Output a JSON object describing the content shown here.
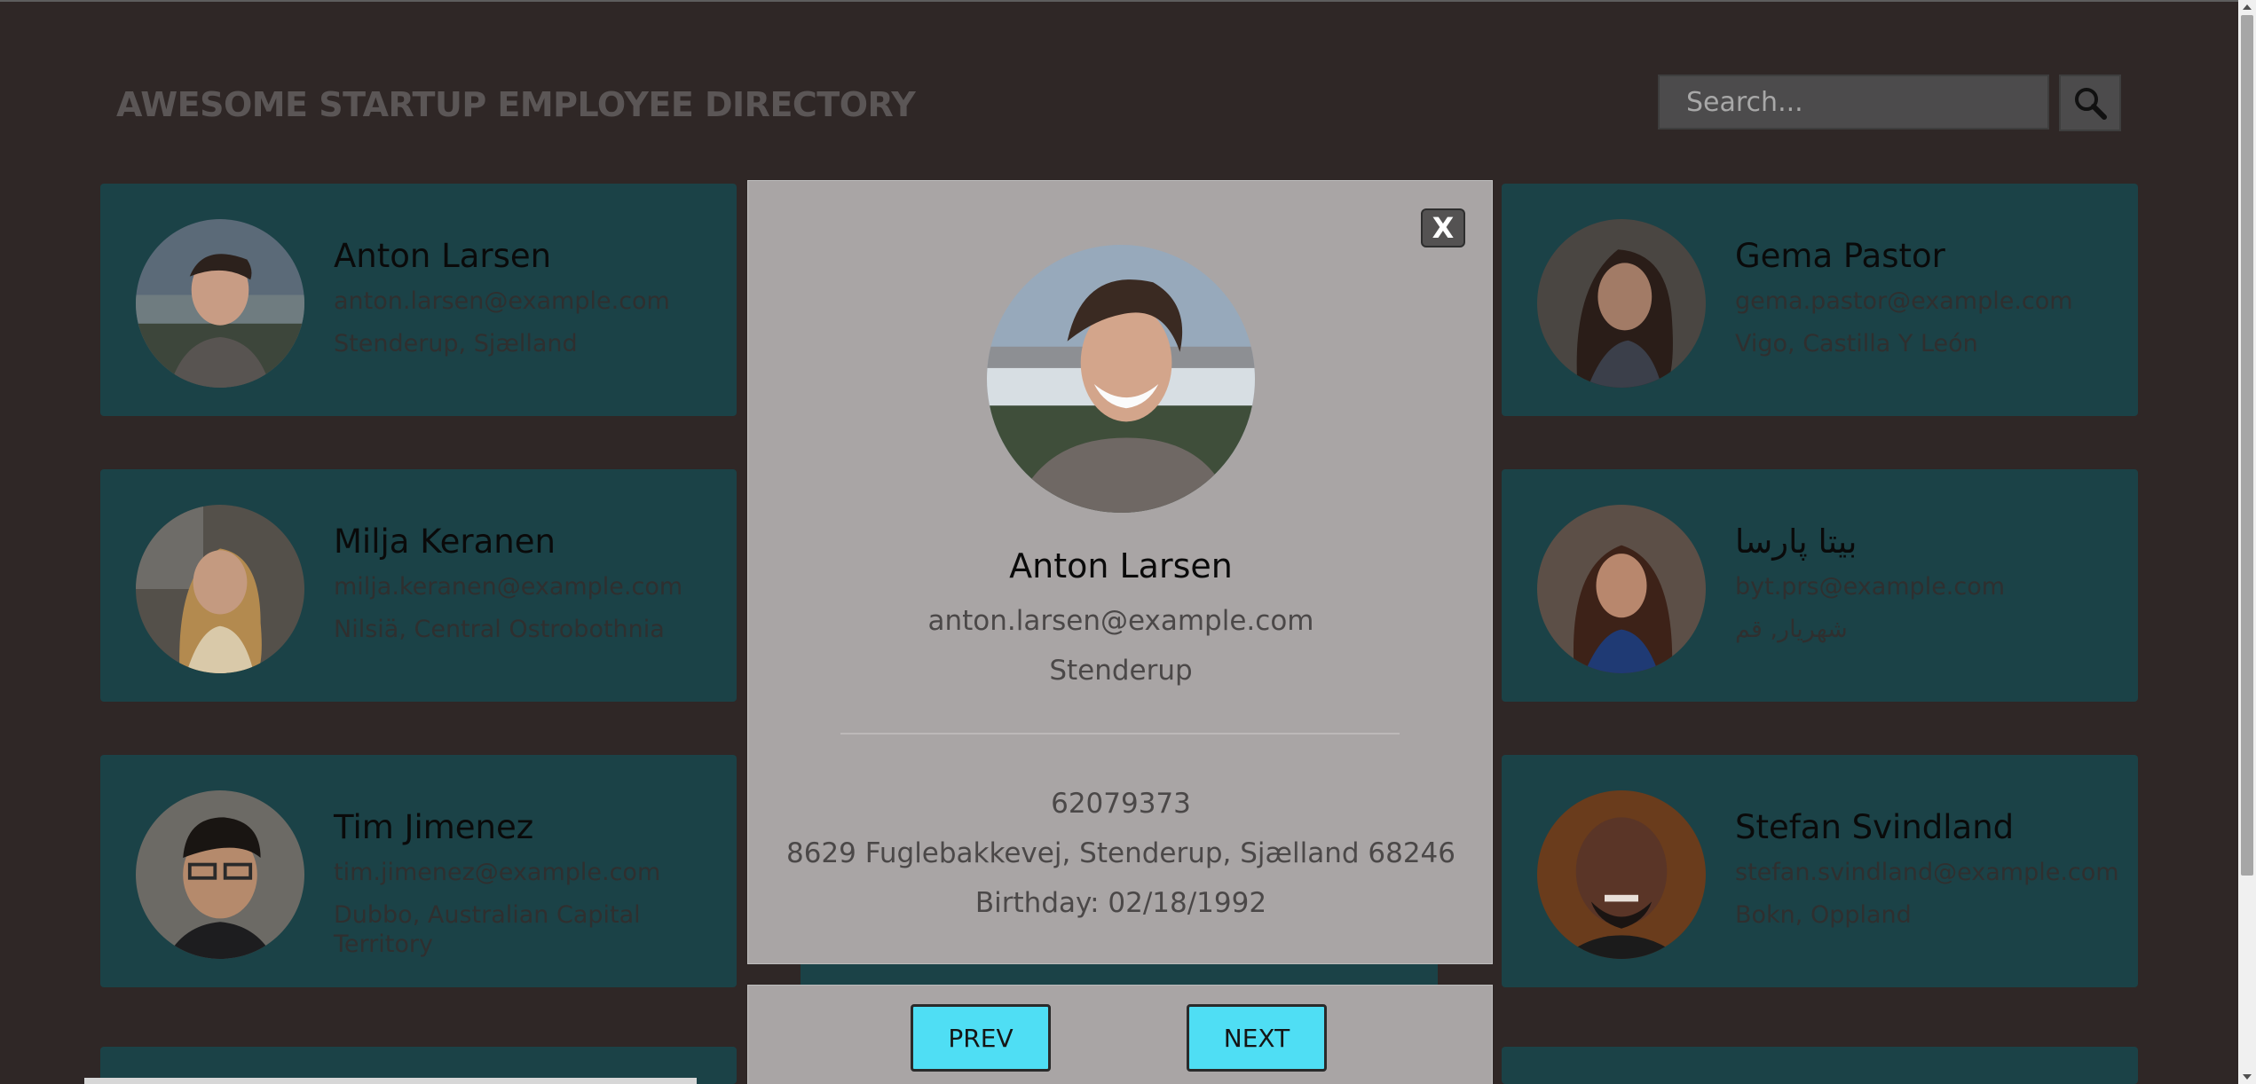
{
  "header": {
    "title": "AWESOME STARTUP EMPLOYEE DIRECTORY",
    "search_placeholder": "Search..."
  },
  "employees": [
    {
      "name": "Anton Larsen",
      "email": "anton.larsen@example.com",
      "location": "Stenderup, Sjælland",
      "avatar": "person-photo"
    },
    {
      "name": "Gema Pastor",
      "email": "gema.pastor@example.com",
      "location": "Vigo, Castilla Y León",
      "avatar": "person-photo"
    },
    {
      "name": "Milja Keranen",
      "email": "milja.keranen@example.com",
      "location": "Nilsiä, Central Ostrobothnia",
      "avatar": "person-photo"
    },
    {
      "name": "بیتا پارسا",
      "email": "byt.prs@example.com",
      "location": "شهریار, قم",
      "avatar": "person-photo"
    },
    {
      "name": "Tim Jimenez",
      "email": "tim.jimenez@example.com",
      "location": "Dubbo, Australian Capital Territory",
      "avatar": "person-photo"
    },
    {
      "name": "Stefan Svindland",
      "email": "stefan.svindland@example.com",
      "location": "Bokn, Oppland",
      "avatar": "person-photo"
    }
  ],
  "modal": {
    "close_label": "X",
    "name": "Anton Larsen",
    "email": "anton.larsen@example.com",
    "city": "Stenderup",
    "phone": "62079373",
    "address": "8629 Fuglebakkevej, Stenderup, Sjælland 68246",
    "birthday": "Birthday: 02/18/1992",
    "prev_label": "PREV",
    "next_label": "NEXT"
  },
  "colors": {
    "background": "#2f2726",
    "card": "#1b4247",
    "modal": "#a9a5a5",
    "nav_button": "#4fdef4"
  }
}
